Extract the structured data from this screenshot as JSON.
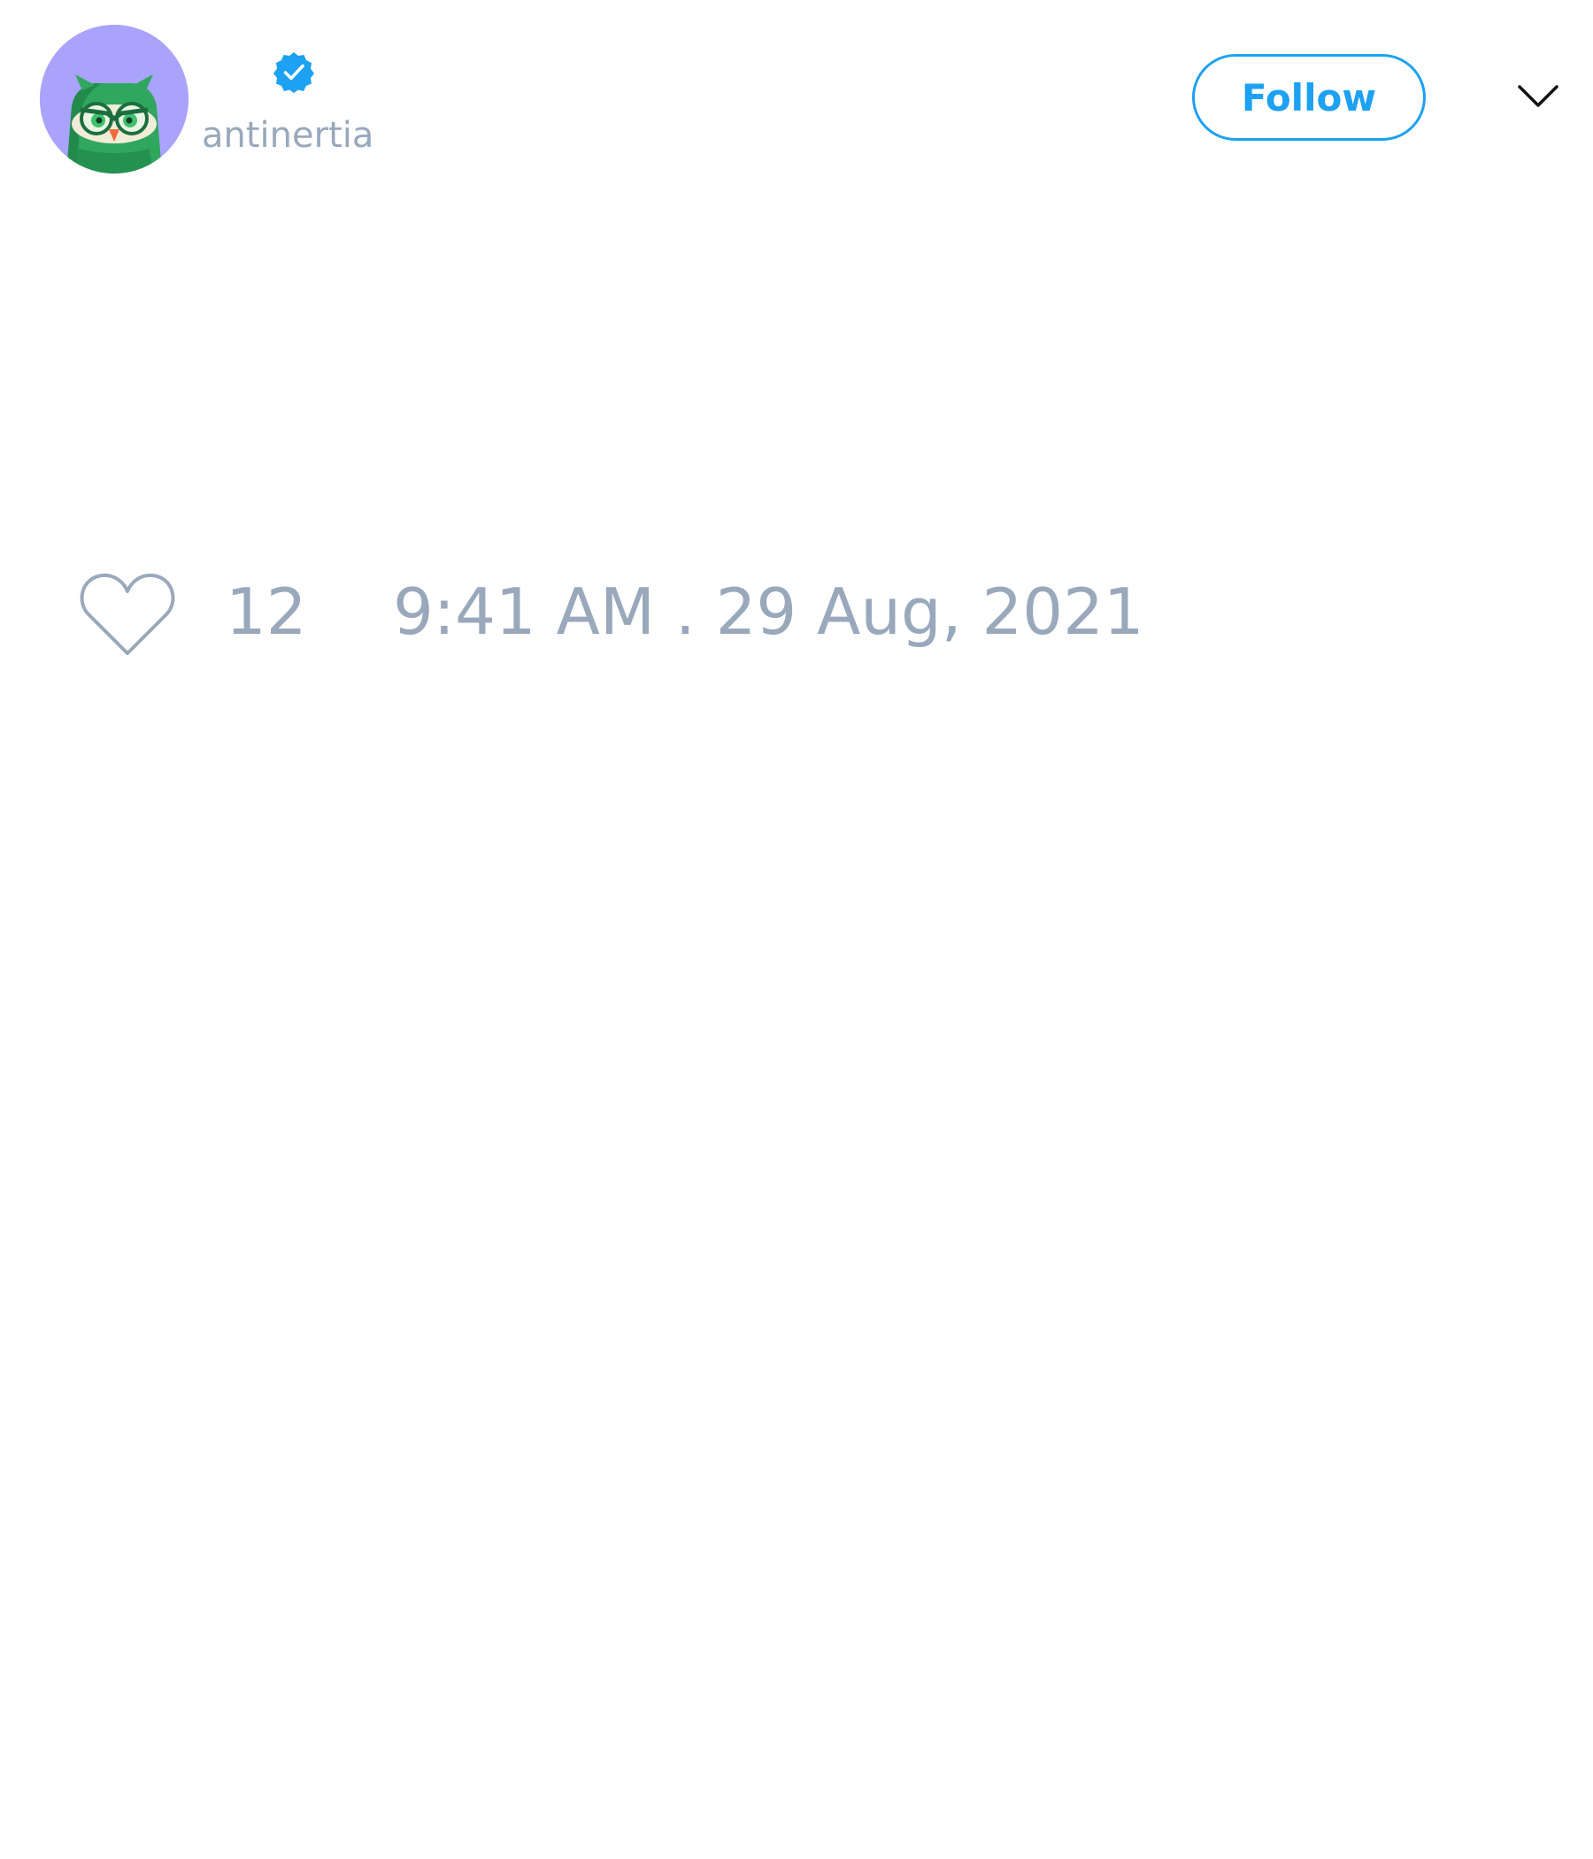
{
  "author": {
    "handle": "antinertia",
    "verified": true,
    "avatar_icon": "green-owl-avatar",
    "avatar_bg_color": "#a9a3fb"
  },
  "header": {
    "follow_label": "Follow",
    "menu_icon": "chevron-down-icon"
  },
  "footer": {
    "like_icon": "heart-icon",
    "like_count": "12",
    "timestamp": "9:41 AM . 29 Aug, 2021"
  },
  "colors": {
    "accent": "#1da1f2",
    "muted_text": "#9aa8bc"
  }
}
